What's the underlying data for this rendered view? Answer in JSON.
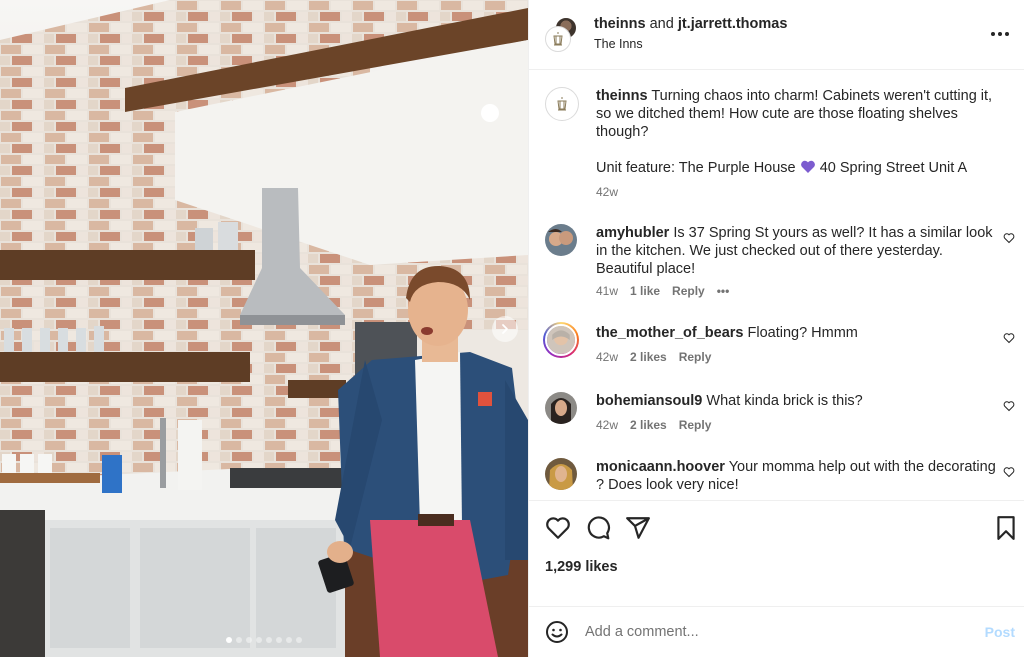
{
  "post": {
    "header": {
      "author_primary": "theinns",
      "connector": "and",
      "author_secondary": "jt.jarrett.thomas",
      "location": "The Inns",
      "more_icon": "more-horizontal-icon"
    },
    "caption": {
      "username": "theinns",
      "text": "Turning chaos into charm! Cabinets weren't cutting it, so we ditched them! How cute are those floating shelves though?",
      "feature_prefix": "Unit feature: The Purple House",
      "feature_suffix": "40 Spring Street Unit A",
      "timestamp": "42w"
    },
    "comments": [
      {
        "username": "amyhubler",
        "text": "Is 37 Spring St yours as well? It has a similar look in the kitchen. We just checked out of there yesterday. Beautiful place!",
        "time": "41w",
        "likes": "1 like",
        "reply": "Reply",
        "more": "•••"
      },
      {
        "username": "the_mother_of_bears",
        "text": "Floating? Hmmm",
        "time": "42w",
        "likes": "2 likes",
        "reply": "Reply"
      },
      {
        "username": "bohemiansoul9",
        "text": "What kinda brick is this?",
        "time": "42w",
        "likes": "2 likes",
        "reply": "Reply"
      },
      {
        "username": "monicaann.hoover",
        "text": "Your momma help out with the decorating ? Does look very nice!",
        "time": "",
        "likes": "",
        "reply": ""
      }
    ],
    "likes_count": "1,299 likes",
    "add_comment": {
      "placeholder": "Add a comment...",
      "post_label": "Post"
    },
    "carousel": {
      "total": 8,
      "active_index": 0
    },
    "colors": {
      "purple_heart": "#7c5ccf",
      "post_disabled": "#b3dbff",
      "text_primary": "#262626",
      "text_secondary": "#737373"
    }
  }
}
